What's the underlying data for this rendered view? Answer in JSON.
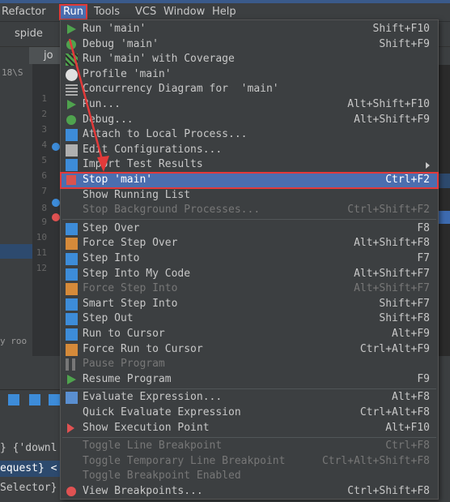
{
  "menubar": {
    "items": [
      "Refactor",
      "Run",
      "Tools",
      "VCS",
      "Window",
      "Help"
    ]
  },
  "background": {
    "breadcrumb": "spide",
    "tab_label": "jo",
    "left_text": "18\\S",
    "left_bottom_text": "y roo",
    "line_numbers": [
      "1",
      "2",
      "3",
      "4",
      "5",
      "6",
      "7",
      "8",
      "9",
      "10",
      "11",
      "12"
    ],
    "bottom_lines": [
      "} {'downl",
      "equest} <",
      "Selector} \""
    ]
  },
  "menu": {
    "items": [
      {
        "label": "Run 'main'",
        "shortcut": "Shift+F10",
        "icon": "run-icon"
      },
      {
        "label": "Debug 'main'",
        "shortcut": "Shift+F9",
        "icon": "debug-icon"
      },
      {
        "label": "Run 'main' with Coverage",
        "shortcut": "",
        "icon": "coverage-icon"
      },
      {
        "label": "Profile 'main'",
        "shortcut": "",
        "icon": "profile-icon"
      },
      {
        "label": "Concurrency Diagram for  'main'",
        "shortcut": "",
        "icon": "concurrency-icon"
      },
      {
        "label": "Run...",
        "shortcut": "Alt+Shift+F10",
        "icon": "run-icon"
      },
      {
        "label": "Debug...",
        "shortcut": "Alt+Shift+F9",
        "icon": "debug-icon"
      },
      {
        "label": "Attach to Local Process...",
        "shortcut": "",
        "icon": "attach-icon"
      },
      {
        "label": "Edit Configurations...",
        "shortcut": "",
        "icon": "edit-config-icon"
      },
      {
        "label": "Import Test Results",
        "shortcut": "",
        "icon": "import-icon"
      },
      {
        "label": "Stop 'main'",
        "shortcut": "Ctrl+F2",
        "icon": "stop-icon"
      },
      {
        "label": "Show Running List",
        "shortcut": "",
        "icon": ""
      },
      {
        "label": "Stop Background Processes...",
        "shortcut": "Ctrl+Shift+F2",
        "icon": ""
      },
      {
        "label": "Step Over",
        "shortcut": "F8",
        "icon": "step-over-icon"
      },
      {
        "label": "Force Step Over",
        "shortcut": "Alt+Shift+F8",
        "icon": "force-step-over-icon"
      },
      {
        "label": "Step Into",
        "shortcut": "F7",
        "icon": "step-into-icon"
      },
      {
        "label": "Step Into My Code",
        "shortcut": "Alt+Shift+F7",
        "icon": "step-into-my-code-icon"
      },
      {
        "label": "Force Step Into",
        "shortcut": "Alt+Shift+F7",
        "icon": "force-step-into-icon"
      },
      {
        "label": "Smart Step Into",
        "shortcut": "Shift+F7",
        "icon": "smart-step-into-icon"
      },
      {
        "label": "Step Out",
        "shortcut": "Shift+F8",
        "icon": "step-out-icon"
      },
      {
        "label": "Run to Cursor",
        "shortcut": "Alt+F9",
        "icon": "run-to-cursor-icon"
      },
      {
        "label": "Force Run to Cursor",
        "shortcut": "Ctrl+Alt+F9",
        "icon": "force-run-to-cursor-icon"
      },
      {
        "label": "Pause Program",
        "shortcut": "",
        "icon": "pause-icon"
      },
      {
        "label": "Resume Program",
        "shortcut": "F9",
        "icon": "resume-icon"
      },
      {
        "label": "Evaluate Expression...",
        "shortcut": "Alt+F8",
        "icon": "evaluate-icon"
      },
      {
        "label": "Quick Evaluate Expression",
        "shortcut": "Ctrl+Alt+F8",
        "icon": ""
      },
      {
        "label": "Show Execution Point",
        "shortcut": "Alt+F10",
        "icon": "execution-point-icon"
      },
      {
        "label": "Toggle Line Breakpoint",
        "shortcut": "Ctrl+F8",
        "icon": ""
      },
      {
        "label": "Toggle Temporary Line Breakpoint",
        "shortcut": "Ctrl+Alt+Shift+F8",
        "icon": ""
      },
      {
        "label": "Toggle Breakpoint Enabled",
        "shortcut": "",
        "icon": ""
      },
      {
        "label": "View Breakpoints...",
        "shortcut": "Ctrl+Shift+F8",
        "icon": "breakpoints-icon"
      }
    ]
  },
  "colors": {
    "menu_bg": "#3c3f41",
    "selection": "#4b6eaf",
    "annotation_red": "#e23a3a",
    "editor_bg": "#2b2b2b"
  }
}
